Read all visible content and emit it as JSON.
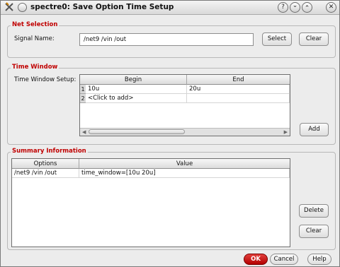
{
  "window": {
    "title": "spectre0: Save Option Time Setup",
    "help_glyph": "?",
    "min_glyph": "⌄",
    "max_glyph": "⌃",
    "close_glyph": "✕"
  },
  "net_selection": {
    "group_title": "Net Selection",
    "signal_label": "Signal Name:",
    "signal_value": "/net9 /vin /out",
    "select_label": "Select",
    "clear_label": "Clear"
  },
  "time_window": {
    "group_title": "Time Window",
    "setup_label": "Time Window Setup:",
    "columns": [
      "Begin",
      "End"
    ],
    "rows": [
      {
        "num": "1",
        "begin": "10u",
        "end": "20u"
      },
      {
        "num": "2",
        "begin": "<Click to add>",
        "end": ""
      }
    ],
    "add_label": "Add"
  },
  "summary": {
    "group_title": "Summary Information",
    "columns": [
      "Options",
      "Value"
    ],
    "rows": [
      {
        "options": "/net9 /vin /out",
        "value": "time_window=[10u 20u]"
      }
    ],
    "delete_label": "Delete",
    "clear_label": "Clear"
  },
  "footer": {
    "ok_label": "OK",
    "cancel_label": "Cancel",
    "help_label": "Help"
  }
}
